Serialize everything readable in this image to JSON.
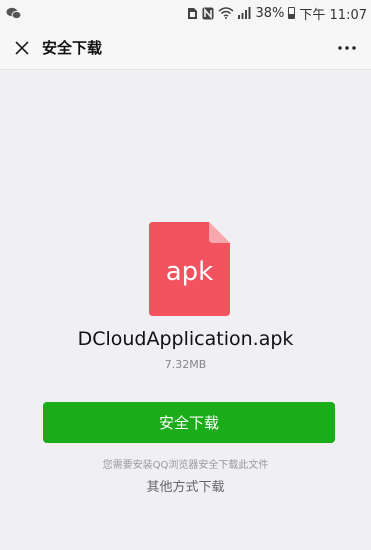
{
  "status_bar": {
    "battery": "38%",
    "time": "下午 11:07",
    "icons": [
      "wechat-icon",
      "sim-icon",
      "nfc-icon",
      "wifi-icon",
      "signal-icon",
      "battery-icon"
    ]
  },
  "nav": {
    "title": "安全下载",
    "close_icon": "close-icon",
    "more_icon": "more-icon"
  },
  "file": {
    "extension": "apk",
    "name": "DCloudApplication.apk",
    "size": "7.32MB",
    "icon_color": "#f3535f"
  },
  "actions": {
    "download_label": "安全下载",
    "download_color": "#1aad19",
    "hint": "您需要安装QQ浏览器安全下载此文件",
    "other_label": "其他方式下载"
  }
}
